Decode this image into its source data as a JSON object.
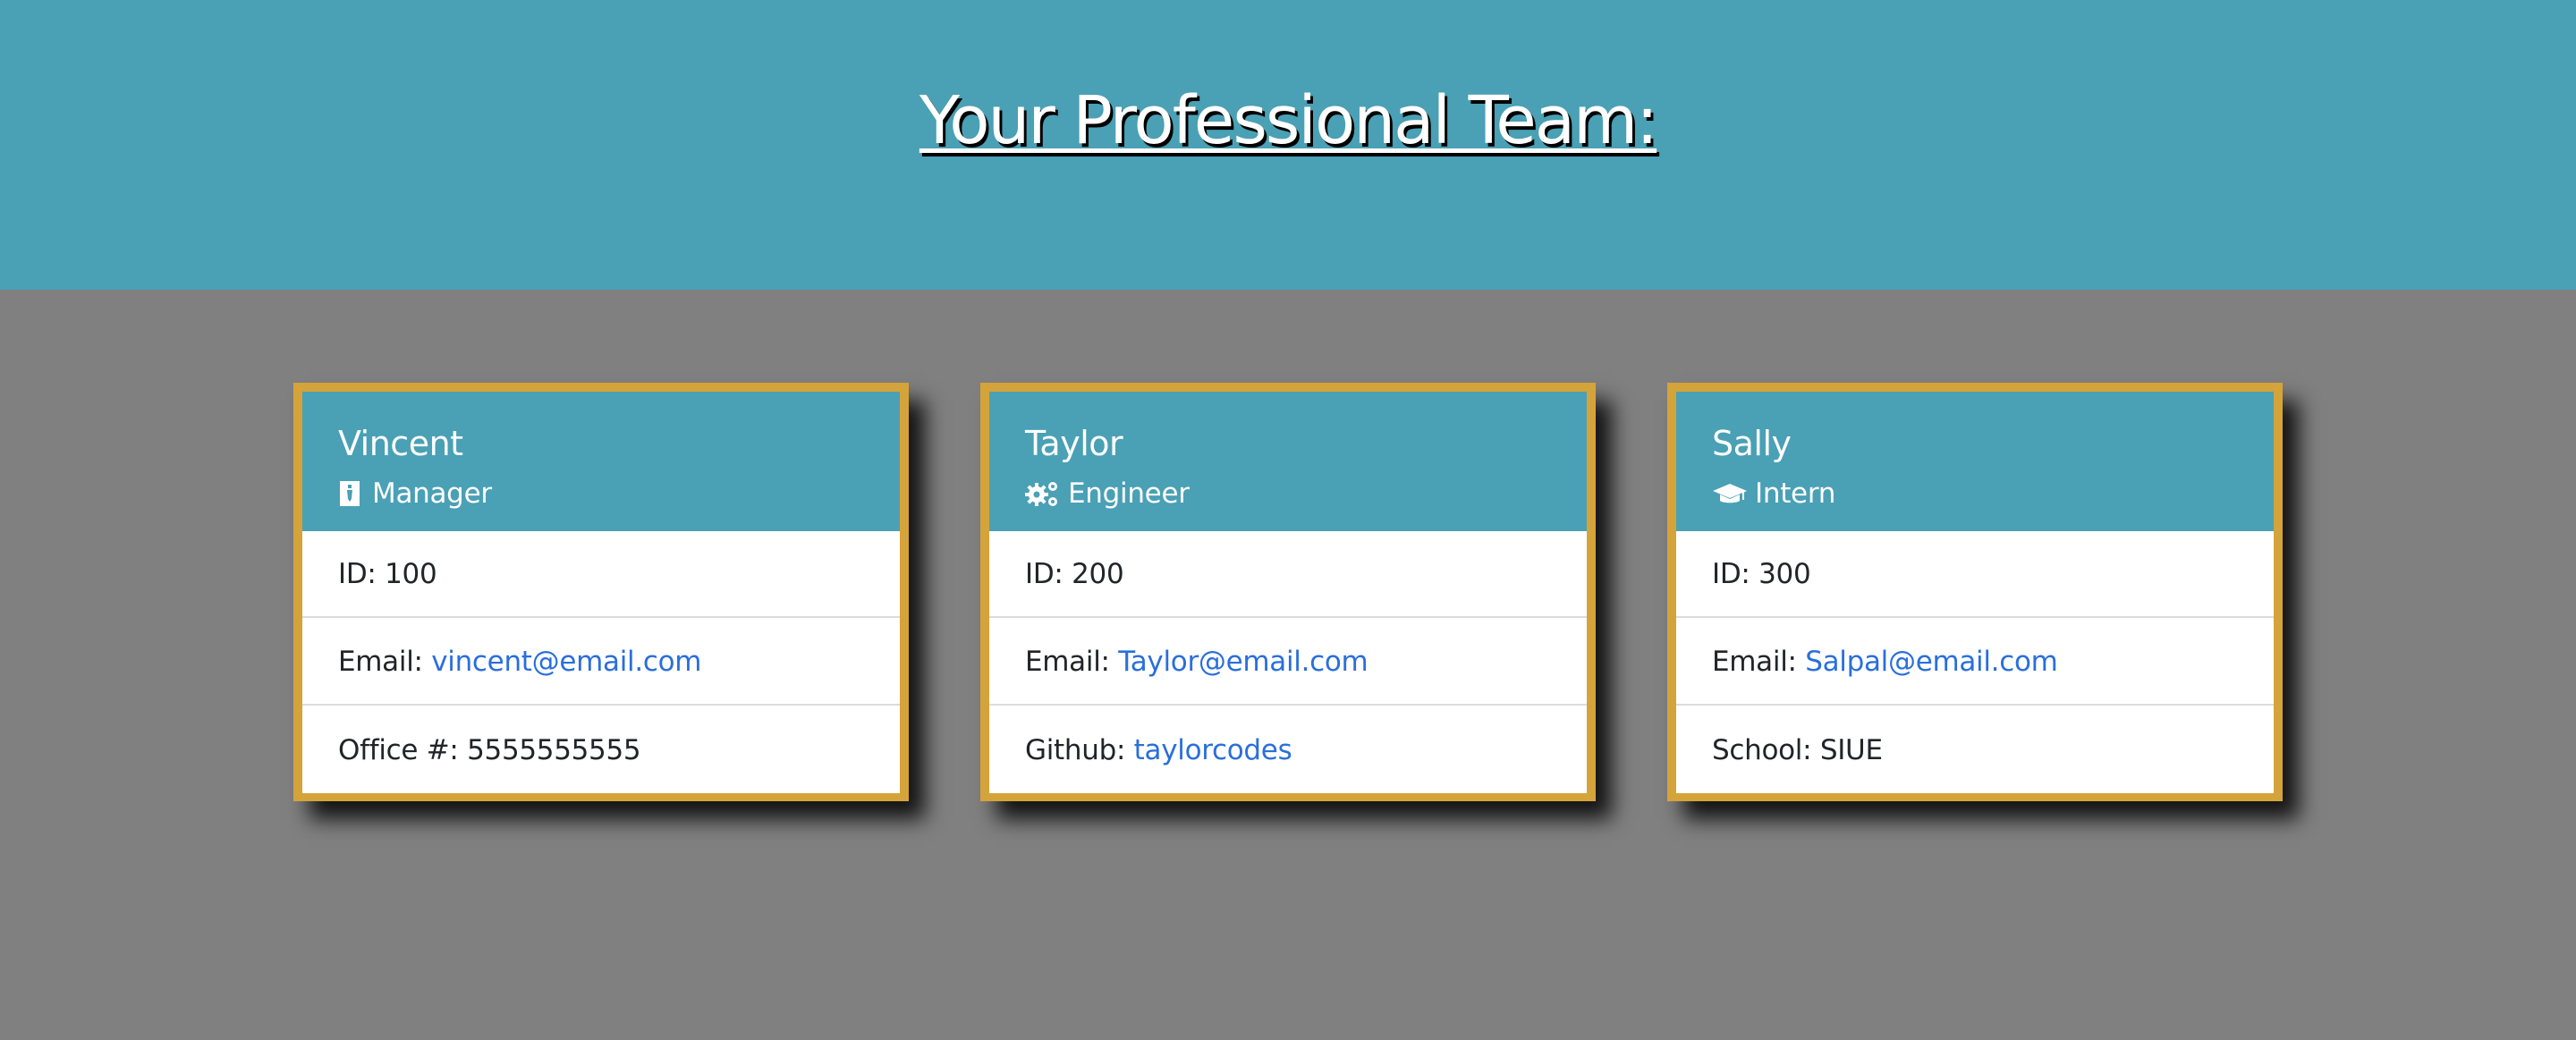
{
  "page": {
    "title": "Your Professional Team:"
  },
  "colors": {
    "header_bg": "#4aa0b5",
    "page_bg": "#808080",
    "card_border": "#d4a43a",
    "link": "#2a6fdb"
  },
  "team": [
    {
      "name": "Vincent",
      "role": "Manager",
      "role_icon": "mug-icon",
      "id_label": "ID: ",
      "id": "100",
      "email_label": "Email: ",
      "email": "vincent@email.com",
      "extra_label": "Office #: ",
      "extra_value": "5555555555",
      "extra_is_link": false
    },
    {
      "name": "Taylor",
      "role": "Engineer",
      "role_icon": "cogs-icon",
      "id_label": "ID: ",
      "id": "200",
      "email_label": "Email: ",
      "email": "Taylor@email.com",
      "extra_label": "Github: ",
      "extra_value": "taylorcodes",
      "extra_is_link": true
    },
    {
      "name": "Sally",
      "role": "Intern",
      "role_icon": "graduation-cap-icon",
      "id_label": "ID: ",
      "id": "300",
      "email_label": "Email: ",
      "email": "Salpal@email.com",
      "extra_label": "School: ",
      "extra_value": "SIUE",
      "extra_is_link": false
    }
  ]
}
